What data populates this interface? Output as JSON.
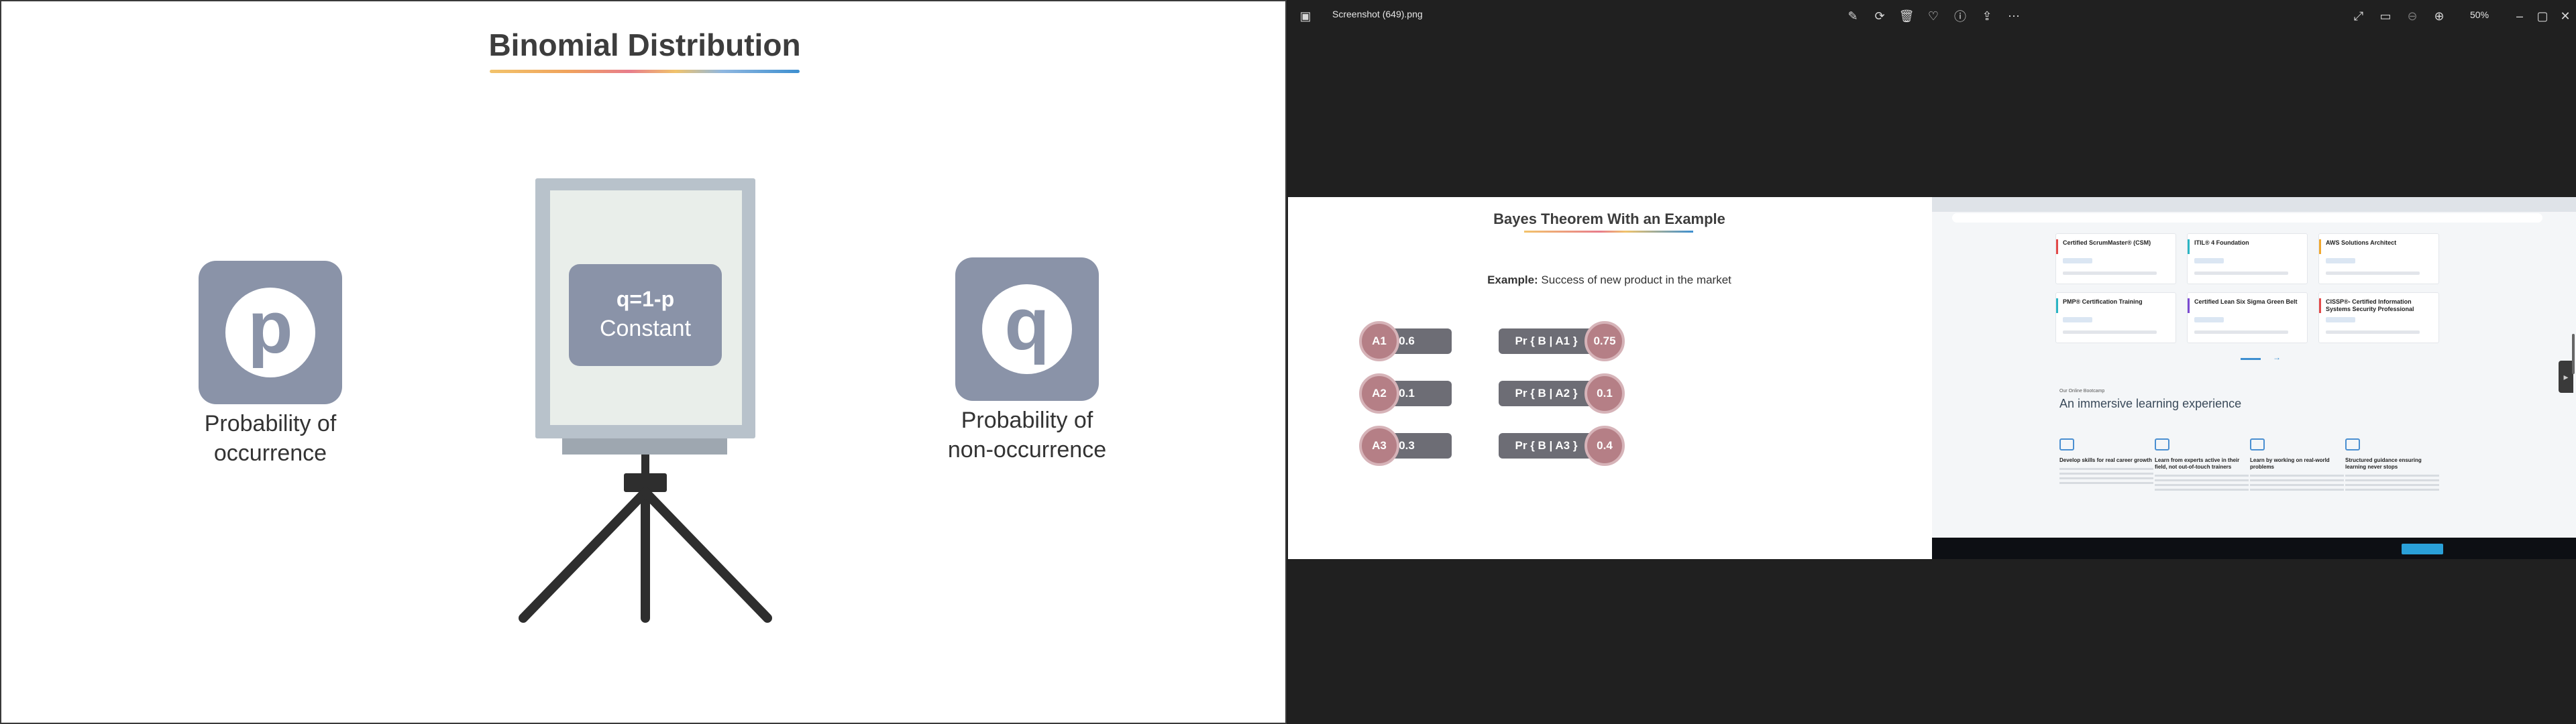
{
  "slide": {
    "title": "Binomial Distribution",
    "p_letter": "p",
    "q_letter": "q",
    "p_caption_line1": "Probability of",
    "p_caption_line2": "occurrence",
    "q_caption_line1": "Probability of",
    "q_caption_line2": "non-occurrence",
    "board_line1": "q=1-p",
    "board_line2": "Constant"
  },
  "viewer": {
    "filename": "Screenshot (649).png",
    "zoom": "50%",
    "toolbar_icons": [
      "edit-image-icon",
      "rotate-icon",
      "delete-icon",
      "favorite-icon",
      "info-icon",
      "share-icon",
      "more-icon"
    ],
    "window_icons": [
      "fullscreen-icon",
      "slideshow-icon",
      "zoom-out-icon",
      "zoom-in-icon"
    ]
  },
  "preview_slide": {
    "title": "Bayes Theorem With an Example",
    "example_label": "Example:",
    "example_text": "Success of new product in the market",
    "events": [
      {
        "label": "A1",
        "value": "0.6"
      },
      {
        "label": "A2",
        "value": "0.1"
      },
      {
        "label": "A3",
        "value": "0.3"
      }
    ],
    "conditionals": [
      {
        "label": "Pr { B | A1 }",
        "value": "0.75"
      },
      {
        "label": "Pr { B | A2 }",
        "value": "0.1"
      },
      {
        "label": "Pr { B | A3 }",
        "value": "0.4"
      }
    ]
  },
  "preview_site": {
    "cards": [
      {
        "name": "Certified ScrumMaster® (CSM)",
        "accent": "#e24a4a"
      },
      {
        "name": "ITIL® 4 Foundation",
        "accent": "#2bb5c4"
      },
      {
        "name": "AWS Solutions Architect",
        "accent": "#f0a830"
      },
      {
        "name": "PMP® Certification Training",
        "accent": "#2bb5c4"
      },
      {
        "name": "Certified Lean Six Sigma Green Belt",
        "accent": "#7a4ad0"
      },
      {
        "name": "CISSP®- Certified Information Systems Security Professional",
        "accent": "#e24a4a"
      }
    ],
    "section_kicker": "Our Online Bootcamp",
    "section_heading": "An immersive learning experience",
    "features": [
      {
        "title": "Develop skills for real career growth"
      },
      {
        "title": "Learn from experts active in their field, not out-of-touch trainers"
      },
      {
        "title": "Learn by working on real-world problems"
      },
      {
        "title": "Structured guidance ensuring learning never stops"
      }
    ]
  }
}
